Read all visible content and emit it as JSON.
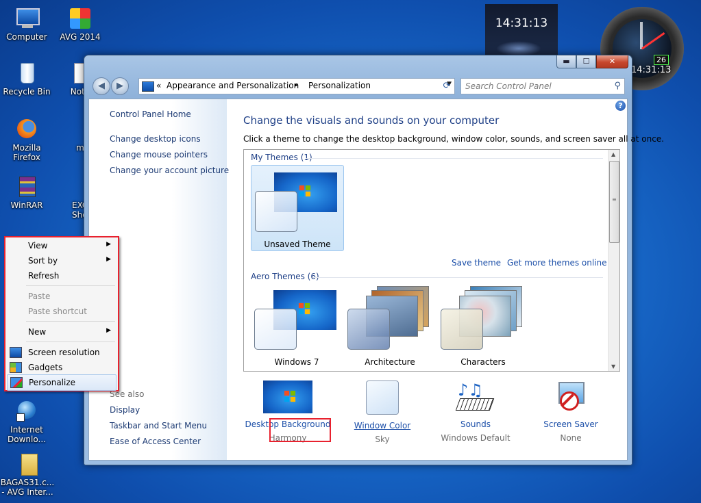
{
  "desktop": {
    "icons": [
      {
        "label": "Computer"
      },
      {
        "label": "AVG 2014"
      },
      {
        "label": "Recycle Bin"
      },
      {
        "label": "Note"
      },
      {
        "label": "Mozilla Firefox"
      },
      {
        "label": "m"
      },
      {
        "label": "WinRAR"
      },
      {
        "label": "EXCE Short"
      },
      {
        "label": "Internet Downlo..."
      },
      {
        "label": "BAGAS31.c... - AVG Inter..."
      }
    ],
    "clock_gadget_time": "14:31:13",
    "analog_clock_badge": "26",
    "analog_clock_time": "14:31:13"
  },
  "window": {
    "caption_buttons": {
      "minimize": "▬",
      "maximize": "☐",
      "close": "✕"
    },
    "nav": {
      "back": "◀",
      "forward": "▶"
    },
    "address": {
      "prefix": "«",
      "crumbs": [
        "Appearance and Personalization",
        "Personalization"
      ],
      "separator": "▸"
    },
    "search_placeholder": "Search Control Panel",
    "left_pane": {
      "home": "Control Panel Home",
      "links": [
        "Change desktop icons",
        "Change mouse pointers",
        "Change your account picture"
      ],
      "see_also_title": "See also",
      "see_also": [
        "Display",
        "Taskbar and Start Menu",
        "Ease of Access Center"
      ]
    },
    "main": {
      "title": "Change the visuals and sounds on your computer",
      "description": "Click a theme to change the desktop background, window color, sounds, and screen saver all at once.",
      "my_themes_title": "My Themes (1)",
      "my_themes": [
        {
          "name": "Unsaved Theme",
          "selected": true
        }
      ],
      "save_theme": "Save theme",
      "get_more": "Get more themes online",
      "aero_title": "Aero Themes (6)",
      "aero_themes": [
        {
          "name": "Windows 7"
        },
        {
          "name": "Architecture"
        },
        {
          "name": "Characters"
        }
      ],
      "bottom": [
        {
          "label": "Desktop Background",
          "value": "Harmony"
        },
        {
          "label": "Window Color",
          "value": "Sky"
        },
        {
          "label": "Sounds",
          "value": "Windows Default"
        },
        {
          "label": "Screen Saver",
          "value": "None"
        }
      ]
    }
  },
  "context_menu": {
    "items": [
      {
        "label": "View",
        "submenu": true
      },
      {
        "label": "Sort by",
        "submenu": true
      },
      {
        "label": "Refresh"
      },
      {
        "label": "Paste",
        "disabled": true
      },
      {
        "label": "Paste shortcut",
        "disabled": true
      },
      {
        "label": "New",
        "submenu": true
      },
      {
        "label": "Screen resolution"
      },
      {
        "label": "Gadgets"
      },
      {
        "label": "Personalize",
        "highlighted": true
      }
    ]
  },
  "colors": {
    "highlight_box": "#e8212e",
    "link": "#1c4fa8",
    "title": "#1e3f86"
  }
}
